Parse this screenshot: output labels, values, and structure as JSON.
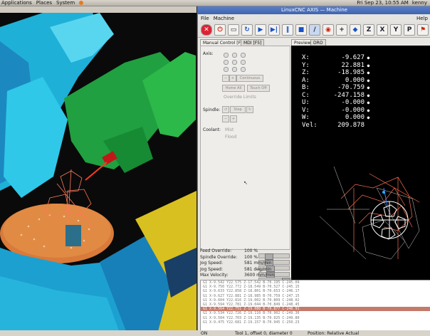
{
  "system_bar": {
    "menus": [
      "Applications",
      "Places",
      "System"
    ],
    "datetime": "Fri Sep 23, 10:55 AM",
    "user": "kenny"
  },
  "window_title": "LinuxCNC AXIS — Machine",
  "menubar": {
    "file": "File",
    "machine": "Machine",
    "help": "Help"
  },
  "toolbar": {
    "estop_icon": "estop-icon",
    "power_icon": "power-icon",
    "buttons": [
      "X",
      "Z",
      "Y",
      "Z",
      "P"
    ]
  },
  "tabs": {
    "manual": "Manual Control [F3]",
    "mdi": "MDI [F5]",
    "preview": "Preview",
    "dro": "DRO"
  },
  "manual": {
    "axis_label": "Axis:",
    "continuous": "Continuous",
    "home_all": "Home All",
    "touch_off": "Touch Off",
    "override_limits": "Override Limits",
    "spindle_label": "Spindle:",
    "stop_label": "Stop",
    "coolant_label": "Coolant:",
    "mist": "Mist",
    "flood": "Flood"
  },
  "dro": [
    {
      "axis": "X:",
      "value": "-9.627"
    },
    {
      "axis": "Y:",
      "value": "22.881"
    },
    {
      "axis": "Z:",
      "value": "-18.985"
    },
    {
      "axis": "A:",
      "value": "0.000"
    },
    {
      "axis": "B:",
      "value": "-70.759"
    },
    {
      "axis": "C:",
      "value": "-247.158"
    },
    {
      "axis": "U:",
      "value": "-0.000"
    },
    {
      "axis": "V:",
      "value": "-0.000"
    },
    {
      "axis": "W:",
      "value": "0.000"
    },
    {
      "axis": "Vel:",
      "value": "209.878"
    }
  ],
  "overrides": [
    {
      "label": "Feed Override:",
      "value": "100 %",
      "level": 0.25
    },
    {
      "label": "Spindle Override:",
      "value": "100 %",
      "level": 0.25
    },
    {
      "label": "Jog Speed:",
      "value": "581 mm/min",
      "level": 0.3
    },
    {
      "label": "Jog Speed:",
      "value": "581 deg/min",
      "level": 0.3
    },
    {
      "label": "Max Velocity:",
      "value": "3600 mm/min",
      "level": 1.0
    }
  ],
  "gcode_lines": [
    "G1 X-9.542 Y22.575 Z-17.542 B-70.195 C-245.09",
    "G1 X-9.750 Y22.772 Z-18.549 B-70.527 C-245.15",
    "G1 X-9.633 Y22.858 Z-18.801 B-70.653 C-246.17",
    "G1 X-9.627 Y22.881 Z-18.985 B-70.759 C-247.15",
    "G1 X-9.604 Y22.816 Z-19.002 B-70.809 C-248.02",
    "G1 X-9.594 Y22.781 Z-19.044 B-70.849 C-248.45",
    "G1 X-9.564 Y22.751 Z-19.080 B-70.877 C-248.91",
    "G1 X-9.534 Y22.726 Z-19.110 B-70.902 C-249.36",
    "G1 X-9.504 Y22.703 Z-19.135 B-70.925 C-249.80",
    "G1 X-9.475 Y22.681 Z-19.157 B-70.945 C-250.23"
  ],
  "gcode_selected_index": 6,
  "status": {
    "state": "ON",
    "tool": "Tool 1, offset 0, diameter 0",
    "position": "Position: Relative Actual"
  }
}
